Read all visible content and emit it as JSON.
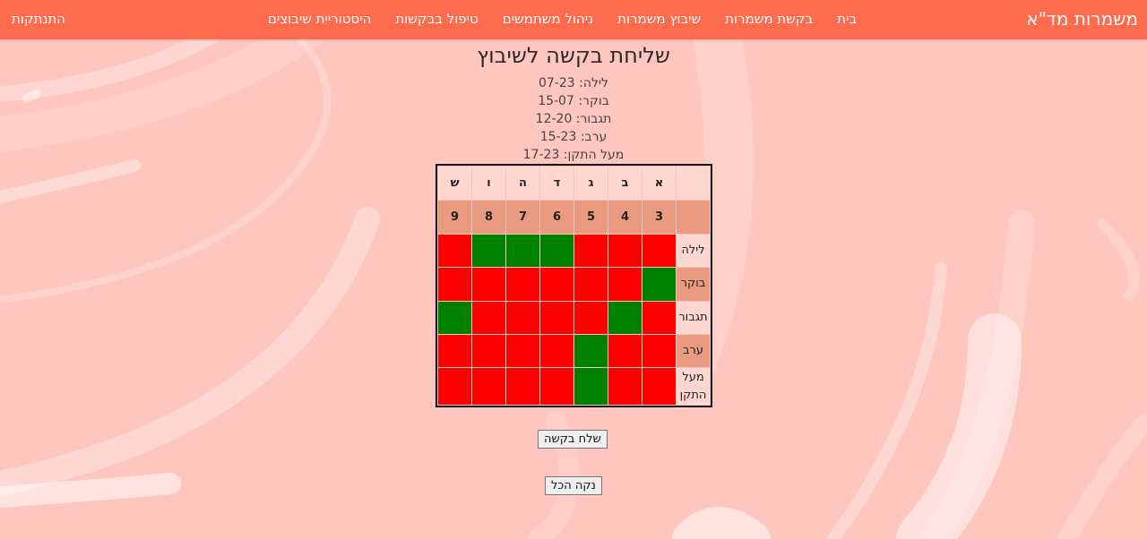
{
  "navbar": {
    "brand": "משמרות מד\"א",
    "links": [
      "בית",
      "בקשת משמרות",
      "שיבוץ משמרות",
      "ניהול משתמשים",
      "טיפול בבקשות",
      "היסטוריית שיבוצים"
    ],
    "logout": "התנתקות"
  },
  "page": {
    "title": "שליחת בקשה לשיבוץ",
    "legend": [
      "לילה: 07-23",
      "בוקר: 15-07",
      "תגבור: 12-20",
      "ערב: 15-23",
      "מעל התקן: 17-23"
    ]
  },
  "schedule": {
    "days": [
      "א",
      "ב",
      "ג",
      "ד",
      "ה",
      "ו",
      "ש"
    ],
    "dates": [
      "3",
      "4",
      "5",
      "6",
      "7",
      "8",
      "9"
    ],
    "shifts": [
      {
        "label": "לילה",
        "cells": [
          "red",
          "red",
          "red",
          "green",
          "green",
          "green",
          "red"
        ]
      },
      {
        "label": "בוקר",
        "cells": [
          "green",
          "red",
          "red",
          "red",
          "red",
          "red",
          "red"
        ]
      },
      {
        "label": "תגבור",
        "cells": [
          "red",
          "green",
          "red",
          "red",
          "red",
          "red",
          "green"
        ]
      },
      {
        "label": "ערב",
        "cells": [
          "red",
          "red",
          "green",
          "red",
          "red",
          "red",
          "red"
        ]
      },
      {
        "label": "מעל התקן",
        "cells": [
          "red",
          "red",
          "green",
          "red",
          "red",
          "red",
          "red"
        ]
      }
    ],
    "colors": {
      "red": "#ff0000",
      "green": "#008000"
    }
  },
  "buttons": {
    "send": "שלח בקשה",
    "clear": "נקה הכל"
  },
  "theme": {
    "navbar": "#ff6b4f",
    "background": "#ffc9c3"
  }
}
